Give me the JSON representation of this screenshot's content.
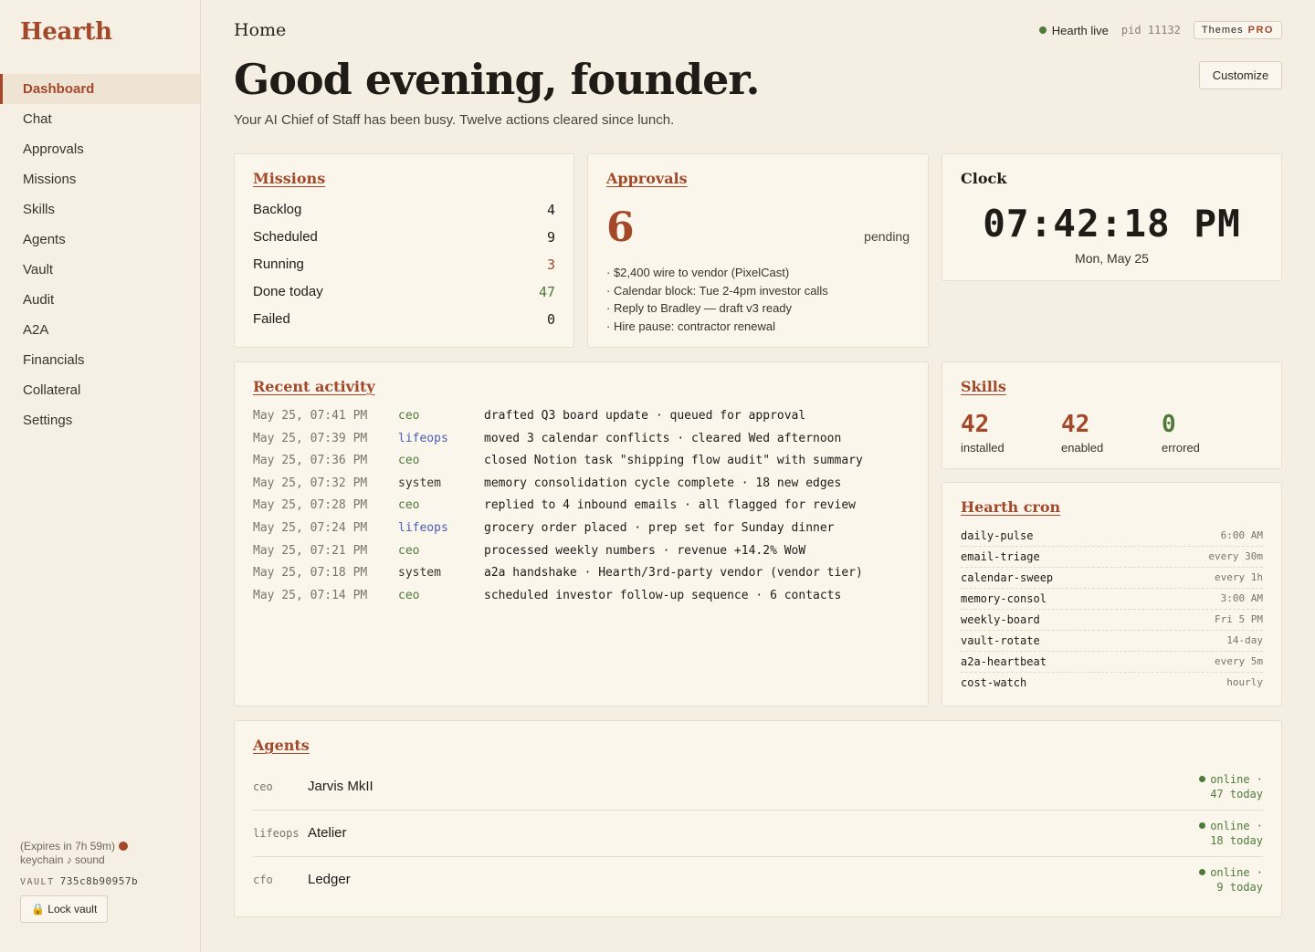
{
  "app": {
    "brand": "Hearth"
  },
  "sidebar": {
    "items": [
      {
        "label": "Dashboard",
        "active": true
      },
      {
        "label": "Chat"
      },
      {
        "label": "Approvals"
      },
      {
        "label": "Missions"
      },
      {
        "label": "Skills"
      },
      {
        "label": "Agents"
      },
      {
        "label": "Vault"
      },
      {
        "label": "Audit"
      },
      {
        "label": "A2A"
      },
      {
        "label": "Financials"
      },
      {
        "label": "Collateral"
      },
      {
        "label": "Settings"
      }
    ],
    "footer": {
      "expires": "(Expires in 7h 59m)",
      "keychain": "keychain ♪ sound",
      "vault_label": "VAULT",
      "vault_id": "735c8b90957b",
      "lock_button": "🔒 Lock vault"
    }
  },
  "header": {
    "breadcrumb": "Home",
    "live_status": "Hearth live",
    "pid": "pid 11132",
    "themes_label": "Themes",
    "themes_badge": "PRO",
    "greeting": "Good evening, founder.",
    "subline": "Your AI Chief of Staff has been busy. Twelve actions cleared since lunch.",
    "customize_button": "Customize"
  },
  "missions": {
    "title": "Missions",
    "rows": [
      {
        "label": "Backlog",
        "value": "4"
      },
      {
        "label": "Scheduled",
        "value": "9"
      },
      {
        "label": "Running",
        "value": "3"
      },
      {
        "label": "Done today",
        "value": "47"
      },
      {
        "label": "Failed",
        "value": "0"
      }
    ]
  },
  "approvals": {
    "title": "Approvals",
    "count": "6",
    "pending_label": "pending",
    "items": [
      "· $2,400 wire to vendor (PixelCast)",
      "· Calendar block: Tue 2-4pm investor calls",
      "· Reply to Bradley — draft v3 ready",
      "· Hire pause: contractor renewal"
    ]
  },
  "clock": {
    "title": "Clock",
    "time": "07:42:18 PM",
    "date": "Mon, May 25"
  },
  "activity": {
    "title": "Recent activity",
    "rows": [
      {
        "time": "May 25, 07:41 PM",
        "agent": "ceo",
        "message": "drafted Q3 board update · queued for approval"
      },
      {
        "time": "May 25, 07:39 PM",
        "agent": "lifeops",
        "message": "moved 3 calendar conflicts · cleared Wed afternoon"
      },
      {
        "time": "May 25, 07:36 PM",
        "agent": "ceo",
        "message": "closed Notion task \"shipping flow audit\" with summary"
      },
      {
        "time": "May 25, 07:32 PM",
        "agent": "system",
        "message": "memory consolidation cycle complete · 18 new edges"
      },
      {
        "time": "May 25, 07:28 PM",
        "agent": "ceo",
        "message": "replied to 4 inbound emails · all flagged for review"
      },
      {
        "time": "May 25, 07:24 PM",
        "agent": "lifeops",
        "message": "grocery order placed · prep set for Sunday dinner"
      },
      {
        "time": "May 25, 07:21 PM",
        "agent": "ceo",
        "message": "processed weekly numbers · revenue +14.2% WoW"
      },
      {
        "time": "May 25, 07:18 PM",
        "agent": "system",
        "message": "a2a handshake · Hearth/3rd-party vendor (vendor tier)"
      },
      {
        "time": "May 25, 07:14 PM",
        "agent": "ceo",
        "message": "scheduled investor follow-up sequence · 6 contacts"
      }
    ]
  },
  "skills": {
    "title": "Skills",
    "stats": [
      {
        "value": "42",
        "label": "installed"
      },
      {
        "value": "42",
        "label": "enabled"
      },
      {
        "value": "0",
        "label": "errored"
      }
    ]
  },
  "cron": {
    "title": "Hearth cron",
    "jobs": [
      {
        "name": "daily-pulse",
        "schedule": "6:00 AM"
      },
      {
        "name": "email-triage",
        "schedule": "every 30m"
      },
      {
        "name": "calendar-sweep",
        "schedule": "every 1h"
      },
      {
        "name": "memory-consol",
        "schedule": "3:00 AM"
      },
      {
        "name": "weekly-board",
        "schedule": "Fri 5 PM"
      },
      {
        "name": "vault-rotate",
        "schedule": "14-day"
      },
      {
        "name": "a2a-heartbeat",
        "schedule": "every 5m"
      },
      {
        "name": "cost-watch",
        "schedule": "hourly"
      }
    ]
  },
  "agents": {
    "title": "Agents",
    "rows": [
      {
        "role": "ceo",
        "name": "Jarvis MkII",
        "status_line1": "online ·",
        "status_line2": "47 today"
      },
      {
        "role": "lifeops",
        "name": "Atelier",
        "status_line1": "online ·",
        "status_line2": "18 today"
      },
      {
        "role": "cfo",
        "name": "Ledger",
        "status_line1": "online ·",
        "status_line2": "9 today"
      }
    ]
  },
  "colors": {
    "accent": "#a4482a",
    "online": "#4f7a3a",
    "lifeops": "#4a5db5",
    "background": "#f5efe3",
    "card": "#faf6ec"
  }
}
